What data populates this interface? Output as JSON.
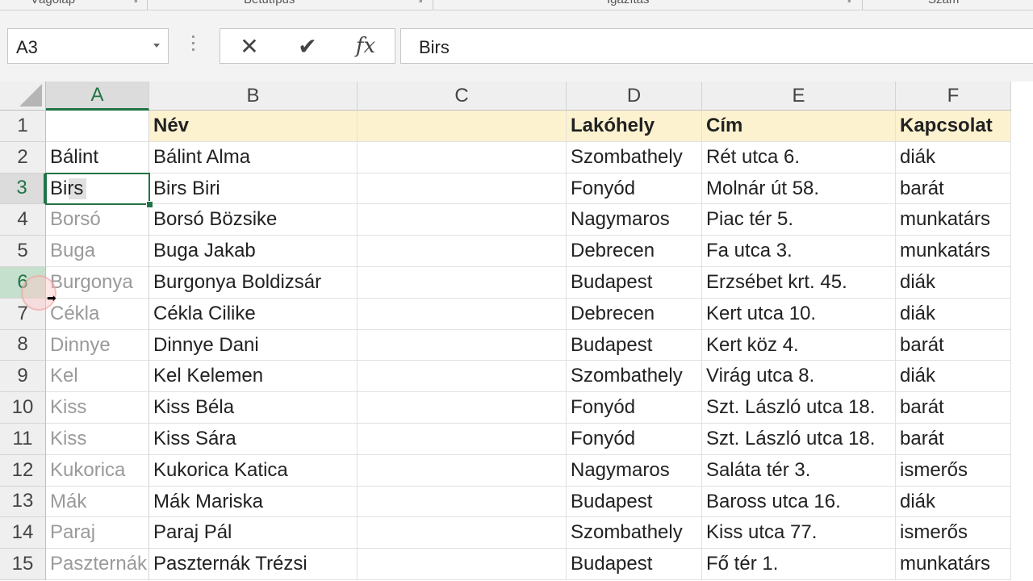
{
  "ribbon": {
    "groups": [
      "Vágólap",
      "Betűtípus",
      "Igazítás",
      "Szám"
    ]
  },
  "namebox": {
    "value": "A3"
  },
  "formula_bar": {
    "cancel_icon": "close-icon",
    "enter_icon": "check-icon",
    "fx_label": "fx",
    "value": "Birs"
  },
  "columns": [
    "A",
    "B",
    "C",
    "D",
    "E",
    "F"
  ],
  "active_cell": "A3",
  "rows": [
    {
      "num": "1",
      "A": "",
      "B": "Név",
      "C": "",
      "D": "Lakóhely",
      "E": "Cím",
      "F": "Kapcsolat"
    },
    {
      "num": "2",
      "A": "Bálint",
      "B": "Bálint Alma",
      "C": "",
      "D": "Szombathely",
      "E": "Rét utca 6.",
      "F": "diák"
    },
    {
      "num": "3",
      "A": "Birs",
      "B": "Birs Biri",
      "C": "",
      "D": "Fonyód",
      "E": "Molnár út 58.",
      "F": "barát"
    },
    {
      "num": "4",
      "A": "Borsó",
      "B": "Borsó Bözsike",
      "C": "",
      "D": "Nagymaros",
      "E": "Piac tér 5.",
      "F": "munkatárs"
    },
    {
      "num": "5",
      "A": "Buga",
      "B": "Buga Jakab",
      "C": "",
      "D": "Debrecen",
      "E": "Fa utca 3.",
      "F": "munkatárs"
    },
    {
      "num": "6",
      "A": "Burgonya",
      "B": "Burgonya Boldizsár",
      "C": "",
      "D": "Budapest",
      "E": "Erzsébet krt. 45.",
      "F": "diák"
    },
    {
      "num": "7",
      "A": "Cékla",
      "B": "Cékla Cilike",
      "C": "",
      "D": "Debrecen",
      "E": "Kert utca 10.",
      "F": "diák"
    },
    {
      "num": "8",
      "A": "Dinnye",
      "B": "Dinnye Dani",
      "C": "",
      "D": "Budapest",
      "E": "Kert köz 4.",
      "F": "barát"
    },
    {
      "num": "9",
      "A": "Kel",
      "B": "Kel Kelemen",
      "C": "",
      "D": "Szombathely",
      "E": "Virág utca 8.",
      "F": "diák"
    },
    {
      "num": "10",
      "A": "Kiss",
      "B": "Kiss Béla",
      "C": "",
      "D": "Fonyód",
      "E": "Szt. László utca 18.",
      "F": "barát"
    },
    {
      "num": "11",
      "A": "Kiss",
      "B": "Kiss Sára",
      "C": "",
      "D": "Fonyód",
      "E": "Szt. László utca 18.",
      "F": "barát"
    },
    {
      "num": "12",
      "A": "Kukorica",
      "B": "Kukorica Katica",
      "C": "",
      "D": "Nagymaros",
      "E": "Saláta tér 3.",
      "F": "ismerős"
    },
    {
      "num": "13",
      "A": "Mák",
      "B": "Mák Mariska",
      "C": "",
      "D": "Budapest",
      "E": "Baross utca 16.",
      "F": "diák"
    },
    {
      "num": "14",
      "A": "Paraj",
      "B": "Paraj Pál",
      "C": "",
      "D": "Szombathely",
      "E": "Kiss utca 77.",
      "F": "ismerős"
    },
    {
      "num": "15",
      "A": "Paszternák",
      "B": "Paszternák Trézsi",
      "C": "",
      "D": "Budapest",
      "E": "Fő tér 1.",
      "F": "munkatárs"
    }
  ],
  "colors": {
    "accent": "#217346",
    "header_fill": "#fdf2d0",
    "flash_fill_preview_text": "#9a9a9a"
  }
}
